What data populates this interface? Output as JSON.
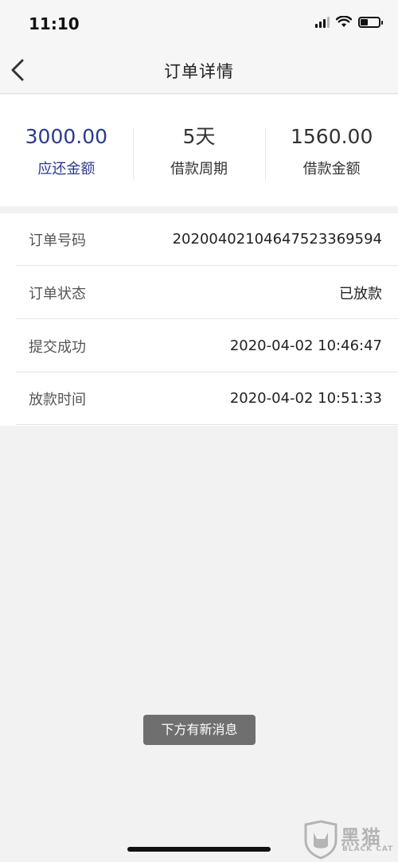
{
  "status_bar": {
    "time": "11:10",
    "icons": [
      "signal-icon",
      "wifi-icon",
      "battery-icon"
    ]
  },
  "nav": {
    "back_icon": "chevron-left-icon",
    "title": "订单详情"
  },
  "summary": {
    "items": [
      {
        "value": "3000.00",
        "label": "应还金额",
        "accent": "#2b3a8c"
      },
      {
        "value": "5天",
        "label": "借款周期"
      },
      {
        "value": "1560.00",
        "label": "借款金额"
      }
    ]
  },
  "details": {
    "rows": [
      {
        "label": "订单号码",
        "value": "20200402104647523369594"
      },
      {
        "label": "订单状态",
        "value": "已放款"
      },
      {
        "label": "提交成功",
        "value": "2020-04-02 10:46:47"
      },
      {
        "label": "放款时间",
        "value": "2020-04-02 10:51:33"
      }
    ]
  },
  "toast": {
    "text": "下方有新消息"
  },
  "watermark": {
    "cn": "黑猫",
    "en": "BLACK CAT"
  }
}
